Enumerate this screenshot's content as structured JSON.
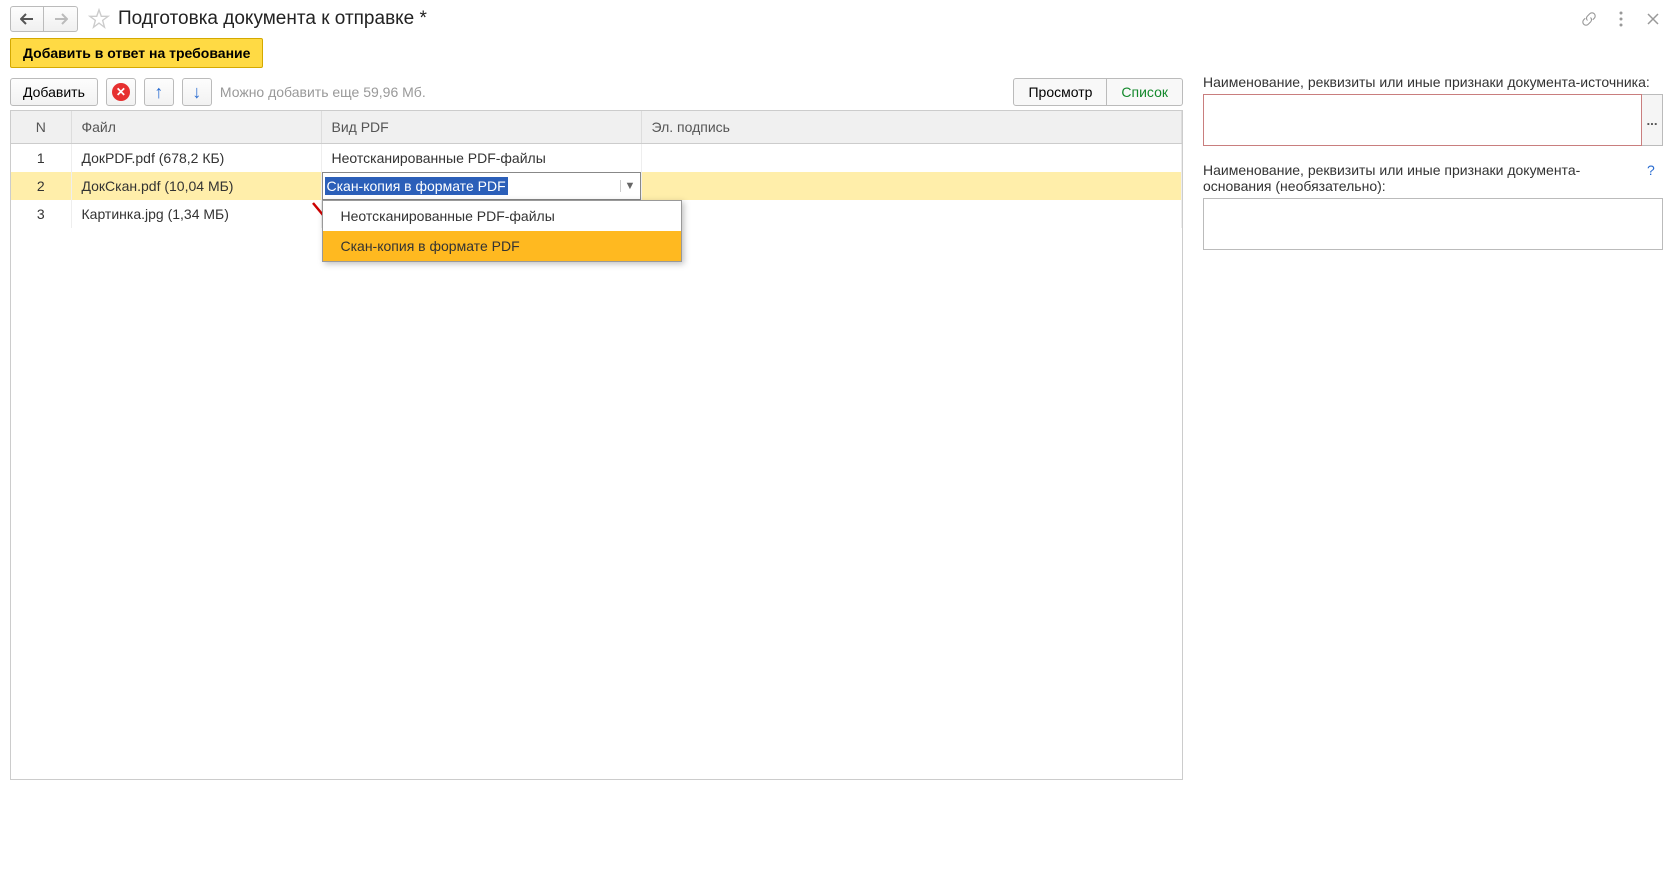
{
  "header": {
    "title": "Подготовка документа к отправке *"
  },
  "actions": {
    "add_to_reply": "Добавить в ответ на требование",
    "add": "Добавить",
    "remaining_hint": "Можно добавить еще 59,96 Мб.",
    "view": "Просмотр",
    "list": "Список"
  },
  "table": {
    "headers": {
      "n": "N",
      "file": "Файл",
      "pdf_type": "Вид PDF",
      "signature": "Эл. подпись"
    },
    "rows": [
      {
        "n": "1",
        "file": "ДокPDF.pdf (678,2 КБ)",
        "pdf_type": "Неотсканированные PDF-файлы",
        "signature": ""
      },
      {
        "n": "2",
        "file": "ДокСкан.pdf (10,04 МБ)",
        "pdf_type": "Скан-копия в формате PDF",
        "signature": ""
      },
      {
        "n": "3",
        "file": "Картинка.jpg (1,34 МБ)",
        "pdf_type": "",
        "signature": ""
      }
    ],
    "dropdown_options": [
      "Неотсканированные PDF-файлы",
      "Скан-копия в формате PDF"
    ]
  },
  "right": {
    "source_label": "Наименование, реквизиты или иные признаки документа-источника:",
    "basis_label": "Наименование, реквизиты или иные признаки документа-основания (необязательно):",
    "help": "?",
    "ellipsis": "..."
  }
}
